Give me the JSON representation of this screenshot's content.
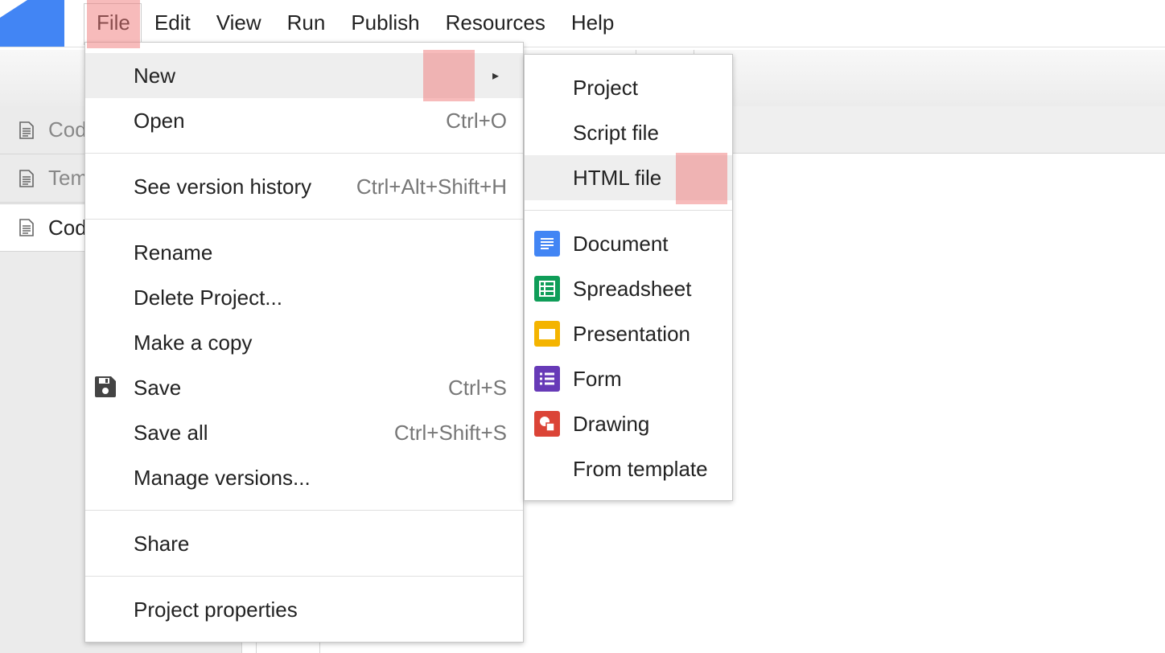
{
  "menubar": {
    "items": [
      {
        "label": "File",
        "active": true
      },
      {
        "label": "Edit"
      },
      {
        "label": "View"
      },
      {
        "label": "Run"
      },
      {
        "label": "Publish"
      },
      {
        "label": "Resources"
      },
      {
        "label": "Help"
      }
    ]
  },
  "sidebar": {
    "files": [
      {
        "name": "Cod",
        "selected": false
      },
      {
        "name": "Tem",
        "selected": false
      },
      {
        "name": "Cod",
        "selected": true
      }
    ]
  },
  "file_menu": {
    "new": {
      "label": "New",
      "arrow": "▸"
    },
    "open": {
      "label": "Open",
      "shortcut": "Ctrl+O"
    },
    "version_history": {
      "label": "See version history",
      "shortcut": "Ctrl+Alt+Shift+H"
    },
    "rename": {
      "label": "Rename"
    },
    "delete": {
      "label": "Delete Project..."
    },
    "copy": {
      "label": "Make a copy"
    },
    "save": {
      "label": "Save",
      "shortcut": "Ctrl+S",
      "icon": "floppy-disk-icon"
    },
    "save_all": {
      "label": "Save all",
      "shortcut": "Ctrl+Shift+S"
    },
    "manage_versions": {
      "label": "Manage versions..."
    },
    "share": {
      "label": "Share"
    },
    "properties": {
      "label": "Project properties"
    }
  },
  "new_submenu": {
    "project": {
      "label": "Project"
    },
    "script": {
      "label": "Script file"
    },
    "html": {
      "label": "HTML file"
    },
    "document": {
      "label": "Document",
      "color": "#4285f4",
      "icon": "docs-icon"
    },
    "spreadsheet": {
      "label": "Spreadsheet",
      "color": "#0f9d58",
      "icon": "sheets-icon"
    },
    "presentation": {
      "label": "Presentation",
      "color": "#f4b400",
      "icon": "slides-icon"
    },
    "form": {
      "label": "Form",
      "color": "#673ab7",
      "icon": "forms-icon"
    },
    "drawing": {
      "label": "Drawing",
      "color": "#db4437",
      "icon": "drawings-icon"
    },
    "template": {
      "label": "From template"
    }
  },
  "colors": {
    "logo": "#4285f4",
    "highlight": "#f07878"
  }
}
